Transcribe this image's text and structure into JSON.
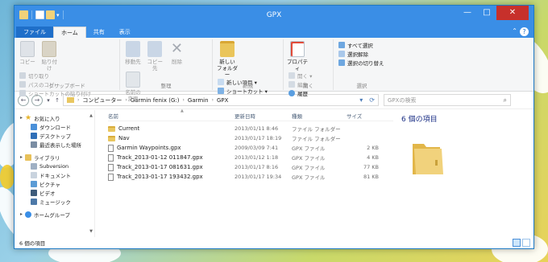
{
  "window": {
    "title": "GPX"
  },
  "ribbon_tabs": [
    "ファイル",
    "ホーム",
    "共有",
    "表示"
  ],
  "ribbon": {
    "clipboard": {
      "name": "クリップボード",
      "copy": "コピー",
      "paste": "貼り付け",
      "cut": "切り取り",
      "copy_path": "パスのコピー",
      "paste_shortcut": "ショートカットの貼り付け"
    },
    "organize": {
      "name": "整理",
      "move_to": "移動先",
      "copy_to": "コピー先",
      "delete": "削除",
      "rename_line1": "名前の",
      "rename_line2": "変更"
    },
    "new": {
      "name": "新規",
      "new_folder_line1": "新しい",
      "new_folder_line2": "フォルダー",
      "new_item": "新しい項目 ▾",
      "shortcut": "ショートカット ▾"
    },
    "open": {
      "name": "開く",
      "properties": "プロパティ",
      "open": "開く ▾",
      "edit": "編集",
      "history": "履歴"
    },
    "select": {
      "name": "選択",
      "select_all": "すべて選択",
      "select_none": "選択解除",
      "invert": "選択の切り替え"
    }
  },
  "address": {
    "crumbs": [
      "コンピューター",
      "Garmin fenix (G:)",
      "Garmin",
      "GPX"
    ],
    "search_placeholder": "GPXの検索"
  },
  "nav_pane": {
    "favorites": "お気に入り",
    "favorites_items": [
      "ダウンロード",
      "デスクトップ",
      "最近表示した場所"
    ],
    "libraries": "ライブラリ",
    "library_items": [
      "Subversion",
      "ドキュメント",
      "ピクチャ",
      "ビデオ",
      "ミュージック"
    ],
    "homegroup": "ホームグループ"
  },
  "columns": {
    "name": "名前",
    "date": "更新日時",
    "type": "種類",
    "size": "サイズ"
  },
  "files": [
    {
      "name": "Current",
      "date": "2013/01/11 8:46",
      "type": "ファイル フォルダー",
      "size": "",
      "kind": "folder"
    },
    {
      "name": "Nav",
      "date": "2013/01/17 18:19",
      "type": "ファイル フォルダー",
      "size": "",
      "kind": "folder"
    },
    {
      "name": "Garmin Waypoints.gpx",
      "date": "2009/03/09 7:41",
      "type": "GPX ファイル",
      "size": "2 KB",
      "kind": "file"
    },
    {
      "name": "Track_2013-01-12 011847.gpx",
      "date": "2013/01/12 1:18",
      "type": "GPX ファイル",
      "size": "4 KB",
      "kind": "file"
    },
    {
      "name": "Track_2013-01-17 081631.gpx",
      "date": "2013/01/17 8:16",
      "type": "GPX ファイル",
      "size": "77 KB",
      "kind": "file"
    },
    {
      "name": "Track_2013-01-17 193432.gpx",
      "date": "2013/01/17 19:34",
      "type": "GPX ファイル",
      "size": "81 KB",
      "kind": "file"
    }
  ],
  "details": {
    "item_count": "6 個の項目"
  },
  "status": {
    "text": "6 個の項目"
  },
  "colors": {
    "titlebar": "#3a8ee6",
    "file_tab": "#1f6fc9",
    "close": "#c7302b",
    "folder": "#e9c760"
  }
}
